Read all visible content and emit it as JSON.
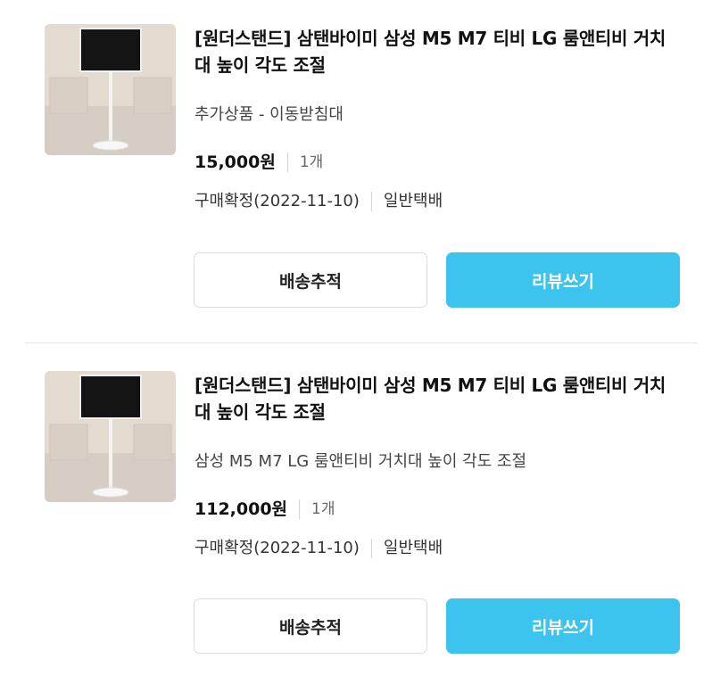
{
  "orders": [
    {
      "title": "[원더스탠드] 삼탠바이미 삼성 M5 M7 티비 LG 룸앤티비 거치대 높이 각도 조절",
      "option": "추가상품 - 이동받침대",
      "price": "15,000원",
      "quantity": "1개",
      "status": "구매확정(2022-11-10)",
      "delivery": "일반택배",
      "track_button": "배송추적",
      "review_button": "리뷰쓰기"
    },
    {
      "title": "[원더스탠드] 삼탠바이미 삼성 M5 M7 티비 LG 룸앤티비 거치대 높이 각도 조절",
      "option": "삼성 M5 M7 LG 룸앤티비 거치대 높이 각도 조절",
      "price": "112,000원",
      "quantity": "1개",
      "status": "구매확정(2022-11-10)",
      "delivery": "일반택배",
      "track_button": "배송추적",
      "review_button": "리뷰쓰기"
    }
  ],
  "colors": {
    "accent": "#3cc3ee",
    "divider": "#e6e6e6"
  }
}
